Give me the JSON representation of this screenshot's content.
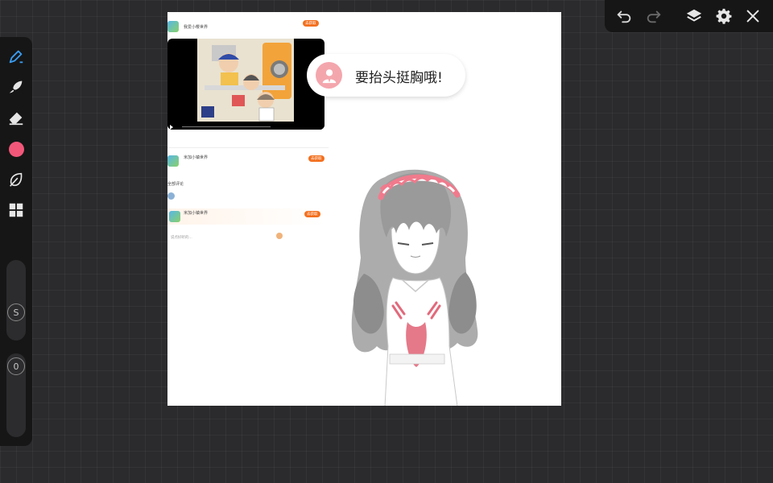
{
  "topbar": {
    "undo_icon": "undo-icon",
    "redo_icon": "redo-icon",
    "layers_icon": "layers-icon",
    "settings_icon": "gear-icon",
    "close_icon": "close-icon"
  },
  "toolbar": {
    "tools": [
      "pen-icon",
      "smudge-icon",
      "eraser-icon",
      "color-swatch",
      "leaf-icon",
      "grid-icon"
    ],
    "active_color": "#f2577a",
    "size_label": "S",
    "opacity_label": "0"
  },
  "speech": {
    "text": "要抬头挺胸哦!"
  },
  "screenshot": {
    "top_title": "",
    "app_name": "我爱小樱世界",
    "chip_get": "去获取",
    "video_time": "",
    "card2_title": "米加小镇世界",
    "card2_sub": "",
    "card2_chip": "去获取",
    "comments_header": "全部评论",
    "comment_text": "",
    "card3_title": "米加小镇世界",
    "card3_chip": "去获取",
    "input_placeholder": "说点好听的..."
  },
  "colors": {
    "accent_orange": "#f36f1d",
    "pink": "#f2577a",
    "hair_gray": "#9a9a9a"
  }
}
